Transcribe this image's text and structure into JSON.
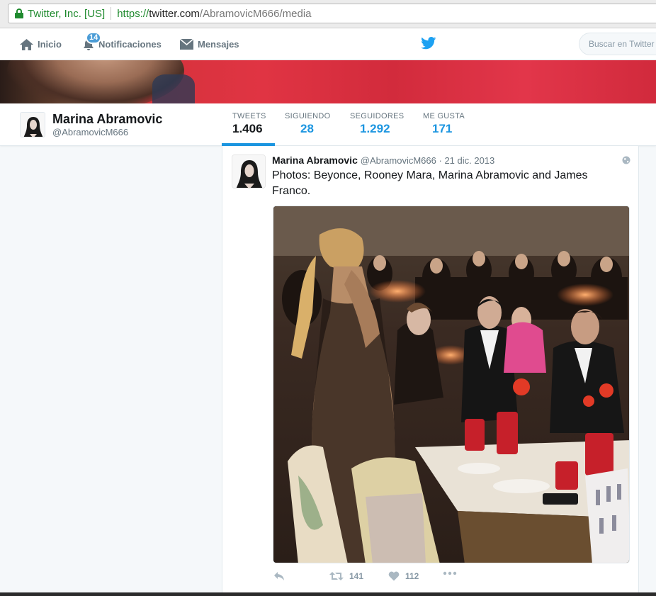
{
  "browser": {
    "ev_name": "Twitter, Inc. [US]",
    "url_scheme": "https://",
    "url_host": "twitter.com",
    "url_path": "/AbramovicM666/media"
  },
  "nav": {
    "home_label": "Inicio",
    "notifications_label": "Notificaciones",
    "notifications_count": "14",
    "messages_label": "Mensajes",
    "search_placeholder": "Buscar en Twitter"
  },
  "profile": {
    "name": "Marina Abramovic",
    "handle": "@AbramovicM666",
    "stats": [
      {
        "label": "TWEETS",
        "value": "1.406",
        "active": true
      },
      {
        "label": "SIGUIENDO",
        "value": "28"
      },
      {
        "label": "SEGUIDORES",
        "value": "1.292"
      },
      {
        "label": "ME GUSTA",
        "value": "171"
      }
    ]
  },
  "tweet": {
    "name": "Marina Abramovic",
    "handle": "@AbramovicM666",
    "separator": " · ",
    "date": "21 dic. 2013",
    "text": "Photos: Beyonce, Rooney Mara, Marina Abramovic and James Franco.",
    "retweets": "141",
    "likes": "112"
  },
  "icons": {
    "lock": "lock-icon",
    "home": "home-icon",
    "notifications": "bell-icon",
    "messages": "envelope-icon",
    "brand": "twitter-bird-icon",
    "visibility": "globe-icon",
    "reply": "reply-icon",
    "retweet": "retweet-icon",
    "like": "heart-icon",
    "more": "more-icon"
  },
  "colors": {
    "accent": "#1b95e0",
    "ev_green": "#1f8a2e",
    "muted": "#66757f"
  }
}
